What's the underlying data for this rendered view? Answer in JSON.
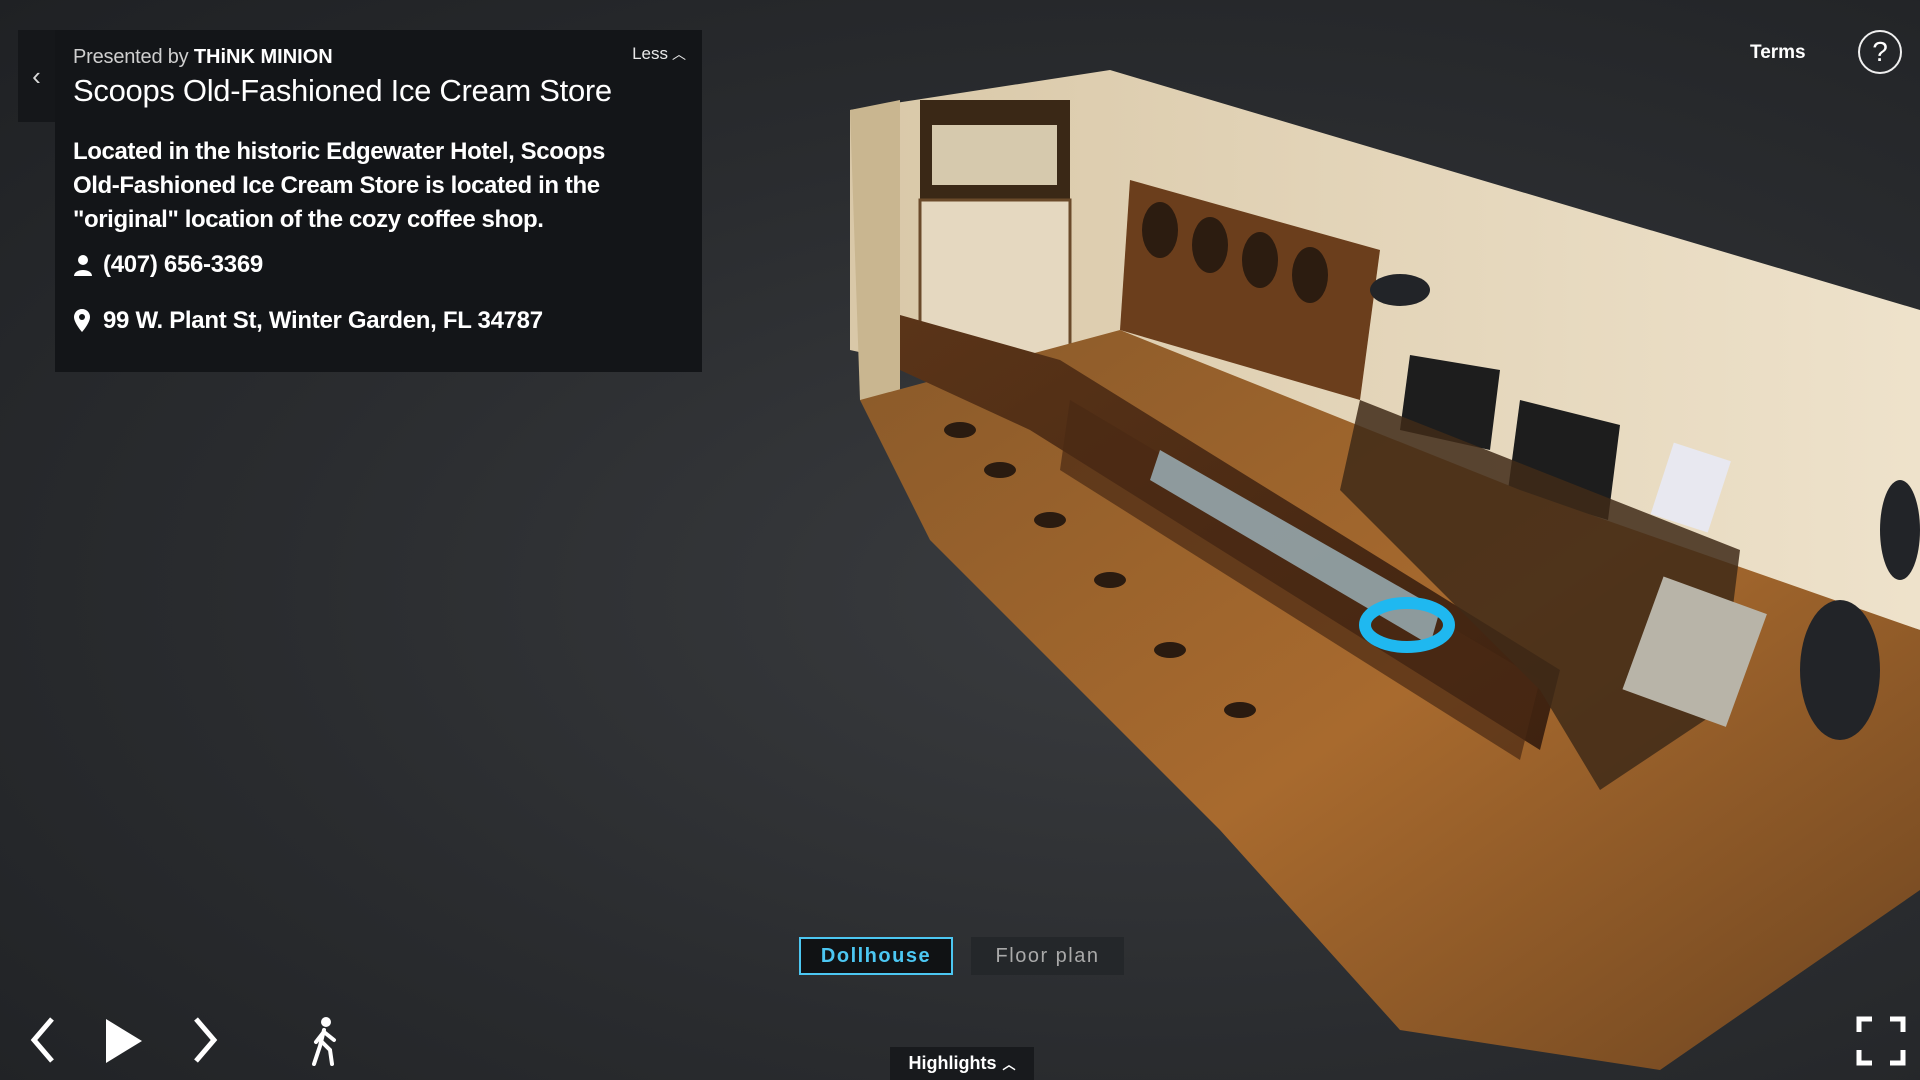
{
  "info": {
    "presented_prefix": "Presented by",
    "presenter": "THiNK MINION",
    "less_label": "Less",
    "title": "Scoops Old-Fashioned Ice Cream Store",
    "description": "Located in the historic Edgewater Hotel, Scoops Old-Fashioned Ice Cream Store is located in the \"original\" location of the cozy coffee shop.",
    "phone": "(407) 656-3369",
    "address": "99 W. Plant St, Winter Garden, FL 34787",
    "collapse_glyph": "‹"
  },
  "top_right": {
    "terms_label": "Terms",
    "help_glyph": "?"
  },
  "views": {
    "dollhouse_label": "Dollhouse",
    "floorplan_label": "Floor plan",
    "active": "Dollhouse"
  },
  "bottom": {
    "highlights_label": "Highlights"
  },
  "icons": {
    "collapse": "chevron-left-icon",
    "less": "chevron-up-icon",
    "phone": "person-icon",
    "address": "map-pin-icon",
    "help": "question-circle-icon",
    "prev": "chevron-left-icon",
    "play": "play-icon",
    "next": "chevron-right-icon",
    "walk": "walking-person-icon",
    "fullscreen": "fullscreen-icon"
  },
  "colors": {
    "accent": "#4cc7f2",
    "panel_bg": "#131518",
    "background": "#2a2c2f"
  }
}
